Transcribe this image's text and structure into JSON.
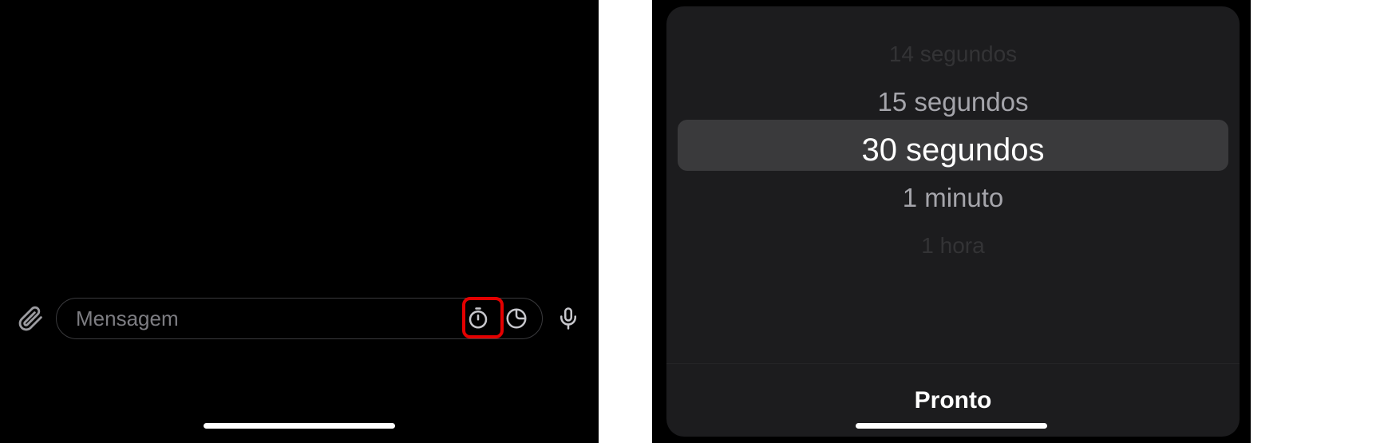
{
  "chat": {
    "input_placeholder": "Mensagem"
  },
  "timer_picker": {
    "options": [
      "14 segundos",
      "15 segundos",
      "30 segundos",
      "1 minuto",
      "1 hora"
    ],
    "selected_index": 2,
    "done_label": "Pronto"
  },
  "annotations": {
    "highlighted_button": "timer-button"
  }
}
